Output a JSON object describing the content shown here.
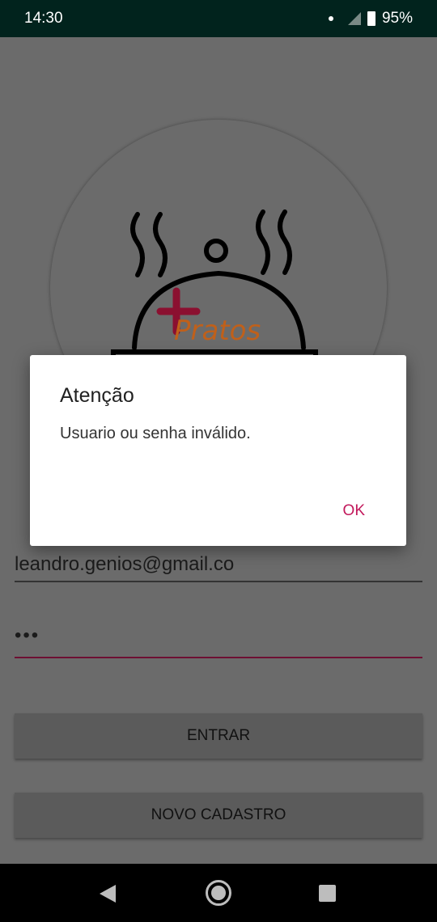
{
  "status_bar": {
    "time": "14:30",
    "battery": "95%"
  },
  "logo": {
    "text": "Pratos",
    "accent_color": "#8b1030",
    "text_color": "#c0601a"
  },
  "form": {
    "email_value": "leandro.genios@gmail.co",
    "password_value": "•••"
  },
  "buttons": {
    "login": "ENTRAR",
    "register": "NOVO CADASTRO"
  },
  "dialog": {
    "title": "Atenção",
    "message": "Usuario ou senha inválido.",
    "ok": "OK",
    "accent_color": "#c2185b"
  }
}
